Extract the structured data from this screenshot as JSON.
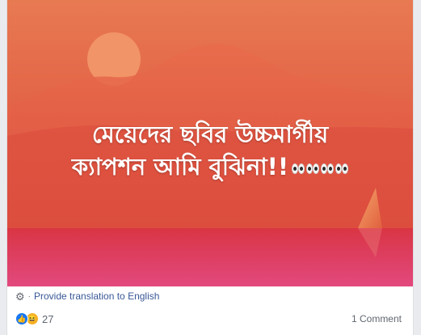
{
  "post": {
    "caption_line1": "মেয়েদের ছবির উচ্চমার্গীয়",
    "caption_line2": "ক্যাপশন আমি বুঝিনা!!",
    "caption_emoji": "eyes-emoji x4",
    "background_colors": {
      "sky_top": "#e8714e",
      "sky_bottom": "#de4a3c",
      "sun": "#f39367",
      "mountain": "#e25c46",
      "water_top": "#dc3e48",
      "water_bottom": "#e2457a"
    }
  },
  "translation": {
    "gear_icon": "gear-icon",
    "link_label": "Provide translation to English"
  },
  "footer": {
    "reaction_icons": [
      "like-icon",
      "haha-icon"
    ],
    "reaction_count": "27",
    "comments_label": "1 Comment"
  },
  "colors": {
    "link": "#385898",
    "muted": "#606770",
    "like_blue": "#1877f2",
    "haha_yellow": "#f7b125"
  }
}
